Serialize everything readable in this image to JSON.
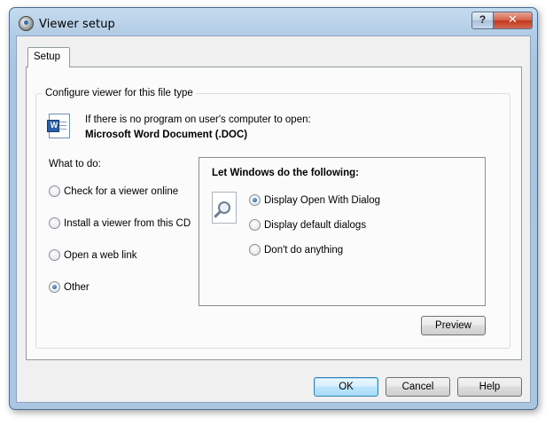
{
  "window": {
    "title": "Viewer setup"
  },
  "titlebar": {
    "help_glyph": "?",
    "close_glyph": "✕"
  },
  "tabs": [
    {
      "label": "Setup",
      "selected": true
    }
  ],
  "group": {
    "title": "Configure viewer for this file type",
    "info_line1": "If there is no program on user's computer to open:",
    "info_line2": "Microsoft Word Document (.DOC)",
    "file_icon": "word-document-icon",
    "doc_letter": "W"
  },
  "what_to_do": {
    "label": "What to do:",
    "options": [
      {
        "label": "Check for a viewer online",
        "checked": false
      },
      {
        "label": "Install a viewer from this CD",
        "checked": false
      },
      {
        "label": "Open a web link",
        "checked": false
      },
      {
        "label": "Other",
        "checked": true
      }
    ]
  },
  "windows_box": {
    "title": "Let Windows do the following:",
    "icon": "magnifier-document-icon",
    "options": [
      {
        "label": "Display Open With Dialog",
        "checked": true
      },
      {
        "label": "Display default dialogs",
        "checked": false
      },
      {
        "label": "Don't do anything",
        "checked": false
      }
    ]
  },
  "buttons": {
    "preview": "Preview",
    "ok": "OK",
    "cancel": "Cancel",
    "help": "Help"
  }
}
